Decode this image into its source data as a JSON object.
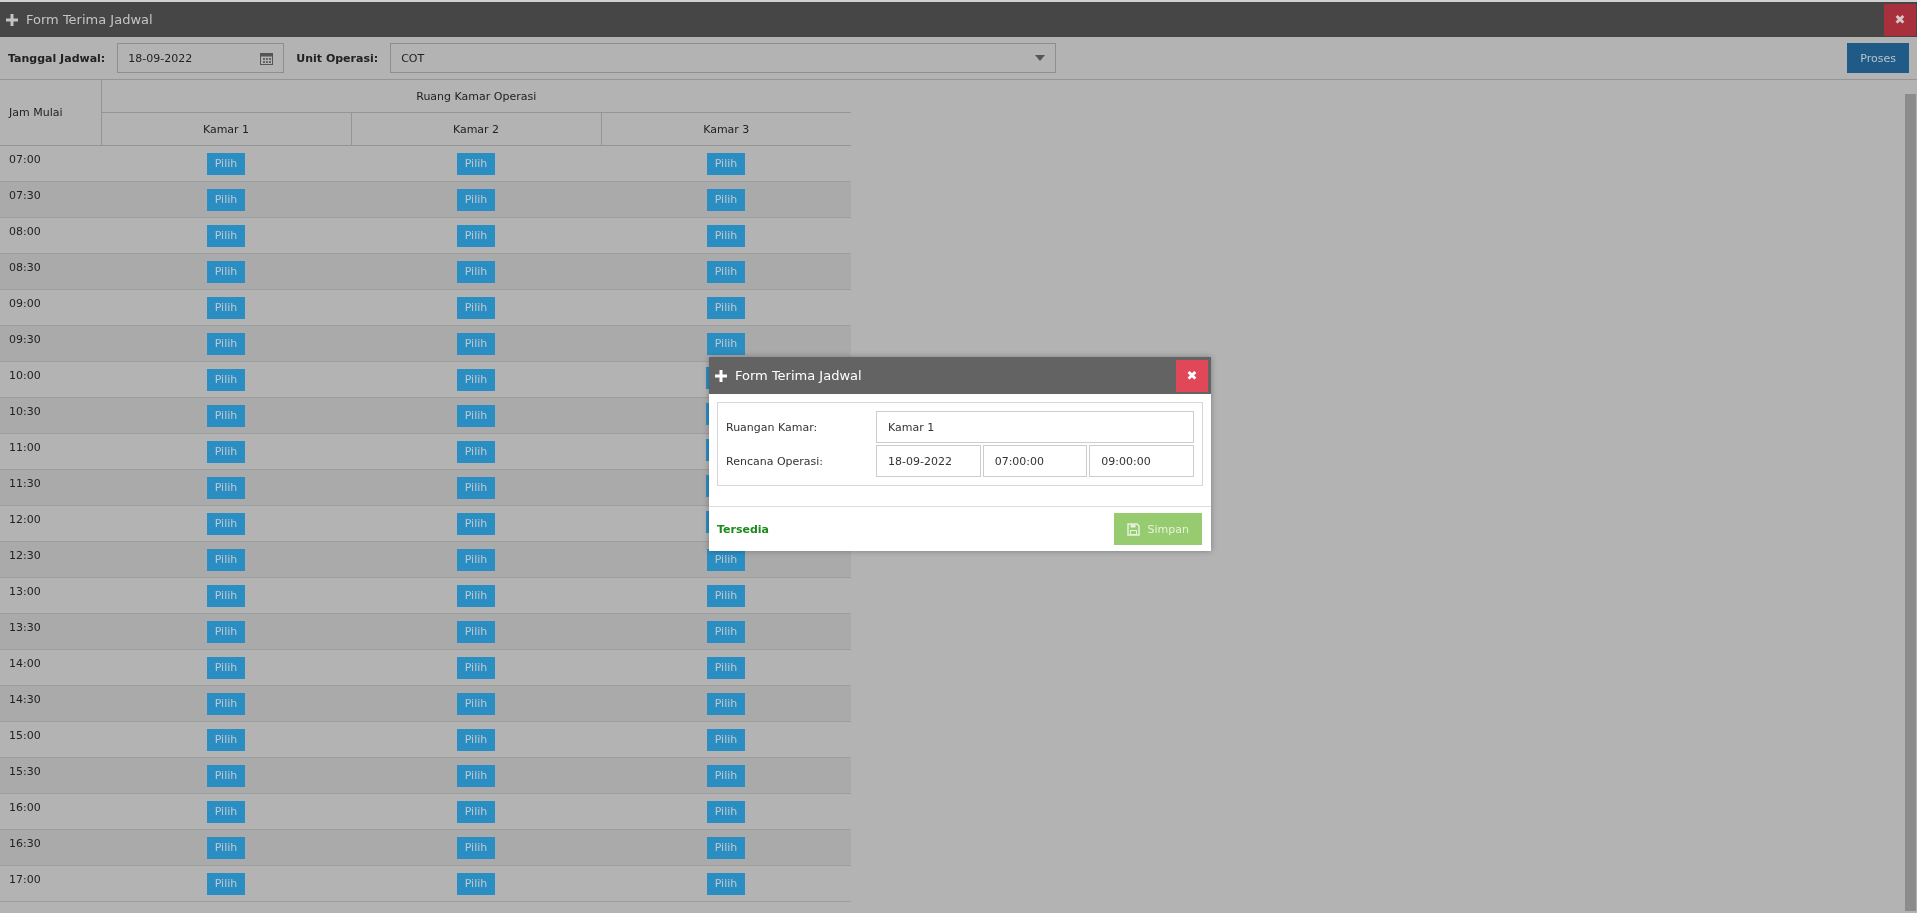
{
  "window": {
    "title": "Form Terima Jadwal",
    "close": "✖"
  },
  "toolbar": {
    "date_label": "Tanggal Jadwal:",
    "date_value": "18-09-2022",
    "unit_label": "Unit Operasi:",
    "unit_value": "COT",
    "process_button": "Proses"
  },
  "table": {
    "time_header": "Jam Mulai",
    "group_header": "Ruang Kamar Operasi",
    "columns": [
      "Kamar 1",
      "Kamar 2",
      "Kamar 3"
    ],
    "rows": [
      {
        "time": "07:00",
        "cells": [
          "Pilih",
          "Pilih",
          "Pilih"
        ]
      },
      {
        "time": "07:30",
        "cells": [
          "Pilih",
          "Pilih",
          "Pilih"
        ]
      },
      {
        "time": "08:00",
        "cells": [
          "Pilih",
          "Pilih",
          "Pilih"
        ]
      },
      {
        "time": "08:30",
        "cells": [
          "Pilih",
          "Pilih",
          "Pilih"
        ]
      },
      {
        "time": "09:00",
        "cells": [
          "Pilih",
          "Pilih",
          "Pilih"
        ]
      },
      {
        "time": "09:30",
        "cells": [
          "Pilih",
          "Pilih",
          "Pilih"
        ]
      },
      {
        "time": "10:00",
        "cells": [
          "Pilih",
          "Pilih",
          null
        ]
      },
      {
        "time": "10:30",
        "cells": [
          "Pilih",
          "Pilih",
          null
        ]
      },
      {
        "time": "11:00",
        "cells": [
          "Pilih",
          "Pilih",
          null
        ]
      },
      {
        "time": "11:30",
        "cells": [
          "Pilih",
          "Pilih",
          null
        ]
      },
      {
        "time": "12:00",
        "cells": [
          "Pilih",
          "Pilih",
          null
        ]
      },
      {
        "time": "12:30",
        "cells": [
          "Pilih",
          "Pilih",
          "Pilih"
        ]
      },
      {
        "time": "13:00",
        "cells": [
          "Pilih",
          "Pilih",
          "Pilih"
        ]
      },
      {
        "time": "13:30",
        "cells": [
          "Pilih",
          "Pilih",
          "Pilih"
        ]
      },
      {
        "time": "14:00",
        "cells": [
          "Pilih",
          "Pilih",
          "Pilih"
        ]
      },
      {
        "time": "14:30",
        "cells": [
          "Pilih",
          "Pilih",
          "Pilih"
        ]
      },
      {
        "time": "15:00",
        "cells": [
          "Pilih",
          "Pilih",
          "Pilih"
        ]
      },
      {
        "time": "15:30",
        "cells": [
          "Pilih",
          "Pilih",
          "Pilih"
        ]
      },
      {
        "time": "16:00",
        "cells": [
          "Pilih",
          "Pilih",
          "Pilih"
        ]
      },
      {
        "time": "16:30",
        "cells": [
          "Pilih",
          "Pilih",
          "Pilih"
        ]
      },
      {
        "time": "17:00",
        "cells": [
          "Pilih",
          "Pilih",
          "Pilih"
        ]
      }
    ]
  },
  "dialog": {
    "title": "Form Terima Jadwal",
    "close": "✖",
    "room_label": "Ruangan Kamar:",
    "room_value": "Kamar 1",
    "plan_label": "Rencana Operasi:",
    "plan_date": "18-09-2022",
    "plan_start": "07:00:00",
    "plan_end": "09:00:00",
    "status": "Tersedia",
    "save_button": "Simpan"
  }
}
